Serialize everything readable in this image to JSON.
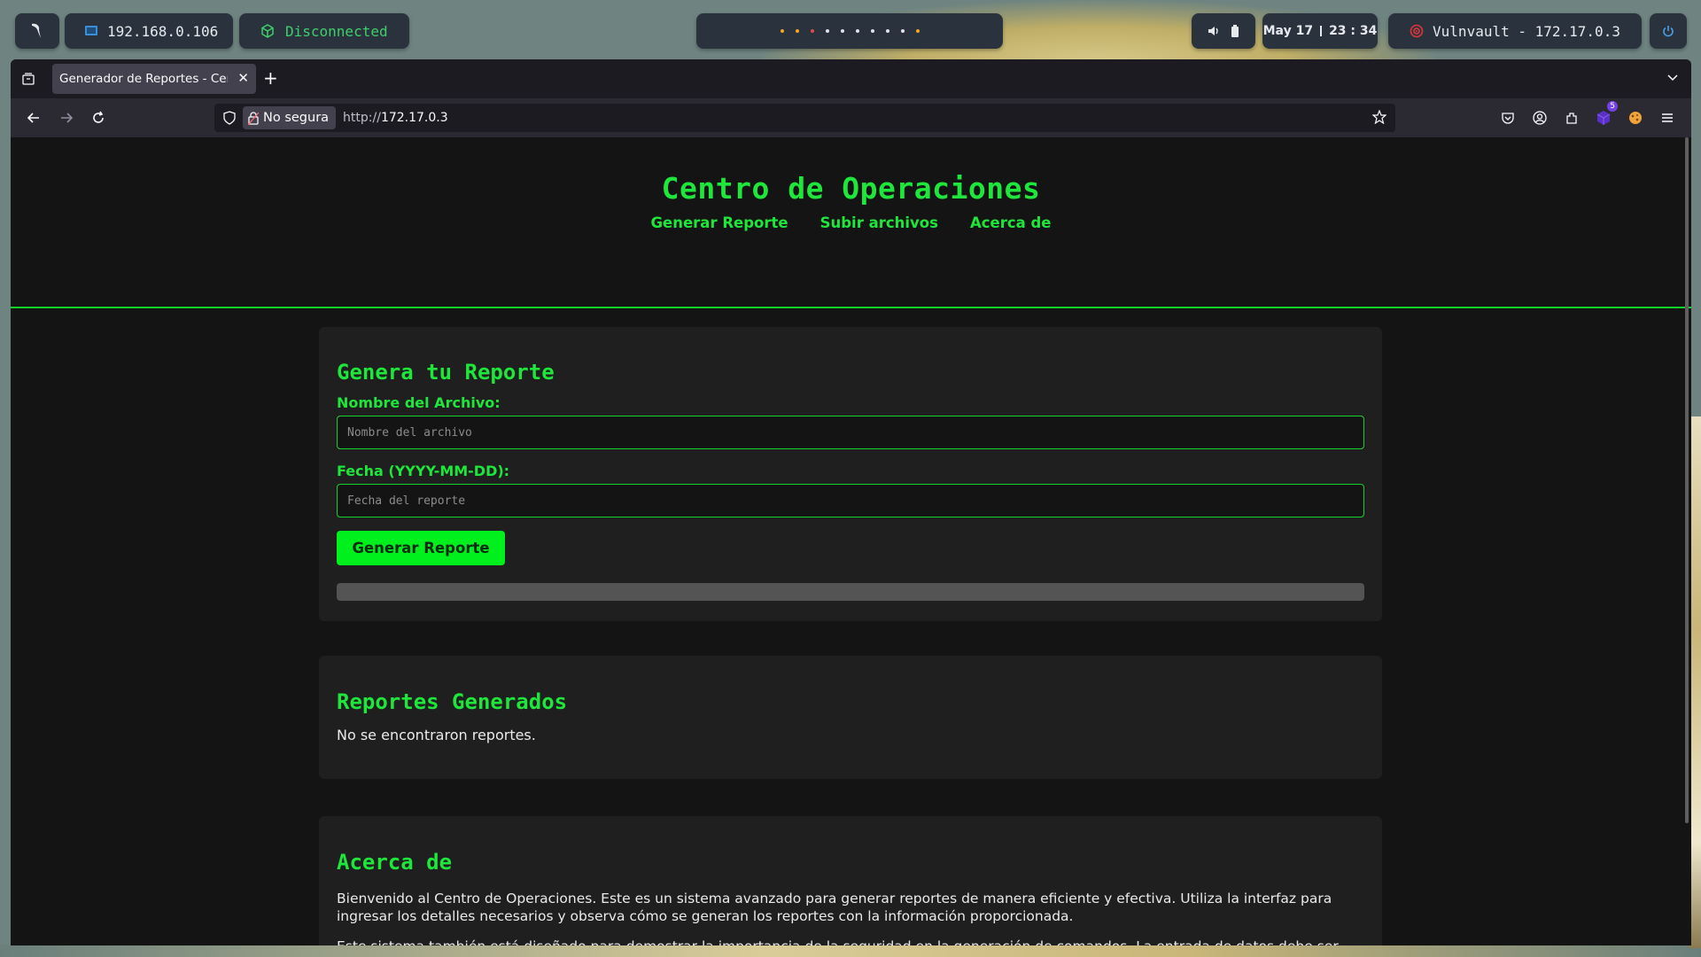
{
  "topbar": {
    "ip": "192.168.0.106",
    "vpn_status": "Disconnected",
    "workspace_dot_colors": [
      "#f5a623",
      "#f5a623",
      "#e24a4a",
      "#dfe3e8",
      "#dfe3e8",
      "#dfe3e8",
      "#dfe3e8",
      "#dfe3e8",
      "#dfe3e8",
      "#f5a623"
    ],
    "clock_date": "May 17",
    "clock_time": "23 : 34",
    "target": "Vulnvault - 172.17.0.3"
  },
  "browser": {
    "tab_title": "Generador de Reportes - Centro de Operaciones",
    "security_label": "No segura",
    "url_scheme": "http://",
    "url_host": "172.17.0.3",
    "extension_badge": "5"
  },
  "page": {
    "title": "Centro de Operaciones",
    "nav": [
      "Generar Reporte",
      "Subir archivos",
      "Acerca de"
    ],
    "form": {
      "heading": "Genera tu Reporte",
      "filename_label": "Nombre del Archivo:",
      "filename_placeholder": "Nombre del archivo",
      "date_label": "Fecha (YYYY-MM-DD):",
      "date_placeholder": "Fecha del reporte",
      "submit_label": "Generar Reporte"
    },
    "reports": {
      "heading": "Reportes Generados",
      "empty_text": "No se encontraron reportes."
    },
    "about": {
      "heading": "Acerca de",
      "paragraphs": [
        "Bienvenido al Centro de Operaciones. Este es un sistema avanzado para generar reportes de manera eficiente y efectiva. Utiliza la interfaz para ingresar los detalles necesarios y observa cómo se generan los reportes con la información proporcionada.",
        "Este sistema también está diseñado para demostrar la importancia de la seguridad en la generación de comandos. La entrada de datos debe ser manejada con cuidado para evitar la inyección de comandos maliciosos."
      ]
    }
  },
  "colors": {
    "accent": "#1ee63a",
    "button": "#00f01e",
    "card_bg": "#1f1f1f",
    "page_bg": "#141414"
  }
}
